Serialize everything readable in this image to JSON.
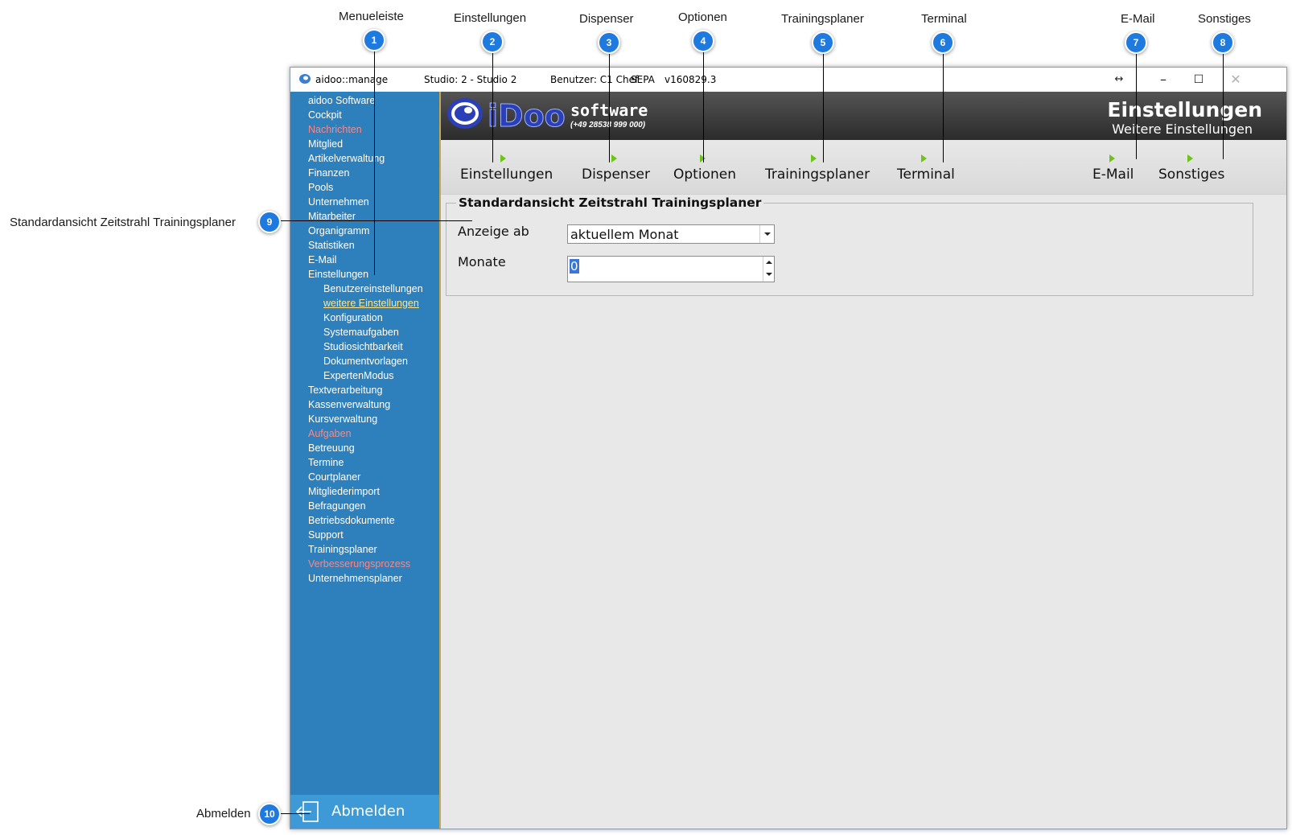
{
  "annotations": {
    "menueleiste": {
      "number": "1",
      "label": "Menueleiste"
    },
    "einstellungen": {
      "number": "2",
      "label": "Einstellungen"
    },
    "dispenser": {
      "number": "3",
      "label": "Dispenser"
    },
    "optionen": {
      "number": "4",
      "label": "Optionen"
    },
    "trainingsplaner": {
      "number": "5",
      "label": "Trainingsplaner"
    },
    "terminal": {
      "number": "6",
      "label": "Terminal"
    },
    "email": {
      "number": "7",
      "label": "E-Mail"
    },
    "sonstiges": {
      "number": "8",
      "label": "Sonstiges"
    },
    "zeitstrahl": {
      "number": "9",
      "label": "Standardansicht Zeitstrahl Trainingsplaner"
    },
    "abmelden": {
      "number": "10",
      "label": "Abmelden"
    }
  },
  "titlebar": {
    "app_name": "aidoo::manage",
    "studio": "Studio: 2 - Studio 2",
    "user": "Benutzer: C1 Chef",
    "sepa": "SEPA",
    "version": "v160829.3",
    "minimize": "–",
    "maximize": "☐",
    "close": "✕",
    "resize_icon": "↔"
  },
  "sidebar": {
    "items": [
      {
        "label": "aidoo Software"
      },
      {
        "label": "Cockpit"
      },
      {
        "label": "Nachrichten"
      },
      {
        "label": "Mitglied"
      },
      {
        "label": "Artikelverwaltung"
      },
      {
        "label": "Finanzen"
      },
      {
        "label": "Pools"
      },
      {
        "label": "Unternehmen"
      },
      {
        "label": "Mitarbeiter"
      },
      {
        "label": "Organigramm"
      },
      {
        "label": "Statistiken"
      },
      {
        "label": "E-Mail"
      },
      {
        "label": "Einstellungen"
      },
      {
        "label": "Benutzereinstellungen"
      },
      {
        "label": "weitere Einstellungen"
      },
      {
        "label": "Konfiguration"
      },
      {
        "label": "Systemaufgaben"
      },
      {
        "label": "Studiosichtbarkeit"
      },
      {
        "label": "Dokumentvorlagen"
      },
      {
        "label": "ExpertenModus"
      },
      {
        "label": "Textverarbeitung"
      },
      {
        "label": "Kassenverwaltung"
      },
      {
        "label": "Kursverwaltung"
      },
      {
        "label": "Aufgaben"
      },
      {
        "label": "Betreuung"
      },
      {
        "label": "Termine"
      },
      {
        "label": "Courtplaner"
      },
      {
        "label": "Mitgliederimport"
      },
      {
        "label": "Befragungen"
      },
      {
        "label": "Betriebsdokumente"
      },
      {
        "label": "Support"
      },
      {
        "label": "Trainingsplaner"
      },
      {
        "label": "Verbesserungsprozess"
      },
      {
        "label": "Unternehmensplaner"
      }
    ],
    "logout_label": "Abmelden"
  },
  "header": {
    "brand": "software",
    "phone": "(+49 28538 999 000)",
    "logo_text": "iDoo",
    "title": "Einstellungen",
    "subtitle": "Weitere Einstellungen"
  },
  "tabs": [
    {
      "label": "Einstellungen"
    },
    {
      "label": "Dispenser"
    },
    {
      "label": "Optionen"
    },
    {
      "label": "Trainingsplaner"
    },
    {
      "label": "Terminal"
    },
    {
      "label": "E-Mail"
    },
    {
      "label": "Sonstiges"
    }
  ],
  "form": {
    "legend": "Standardansicht Zeitstrahl Trainingsplaner",
    "anzeige_label": "Anzeige ab",
    "anzeige_value": "aktuellem Monat",
    "monate_label": "Monate",
    "monate_value": "0"
  },
  "colors": {
    "sidebar": "#2e80bd",
    "sidebar_alert": "#f28a8a",
    "sidebar_active": "#ffe58a",
    "badge": "#1f7ae0",
    "tab_arrow": "#6cc416"
  }
}
